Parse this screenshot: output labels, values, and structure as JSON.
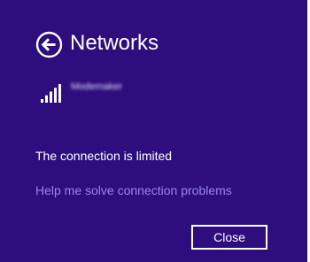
{
  "panel": {
    "title": "Networks",
    "back_icon": "back-arrow-circle-icon",
    "background_color": "#2e0e7e"
  },
  "network": {
    "name": "Modemaker",
    "signal_icon": "wifi-signal-bars-icon",
    "signal_bars": 5,
    "signal_bars_lit": 5
  },
  "status": {
    "message": "The connection is limited"
  },
  "help": {
    "link_text": "Help me solve connection problems",
    "link_color": "#9d82f2"
  },
  "actions": {
    "close_label": "Close"
  }
}
